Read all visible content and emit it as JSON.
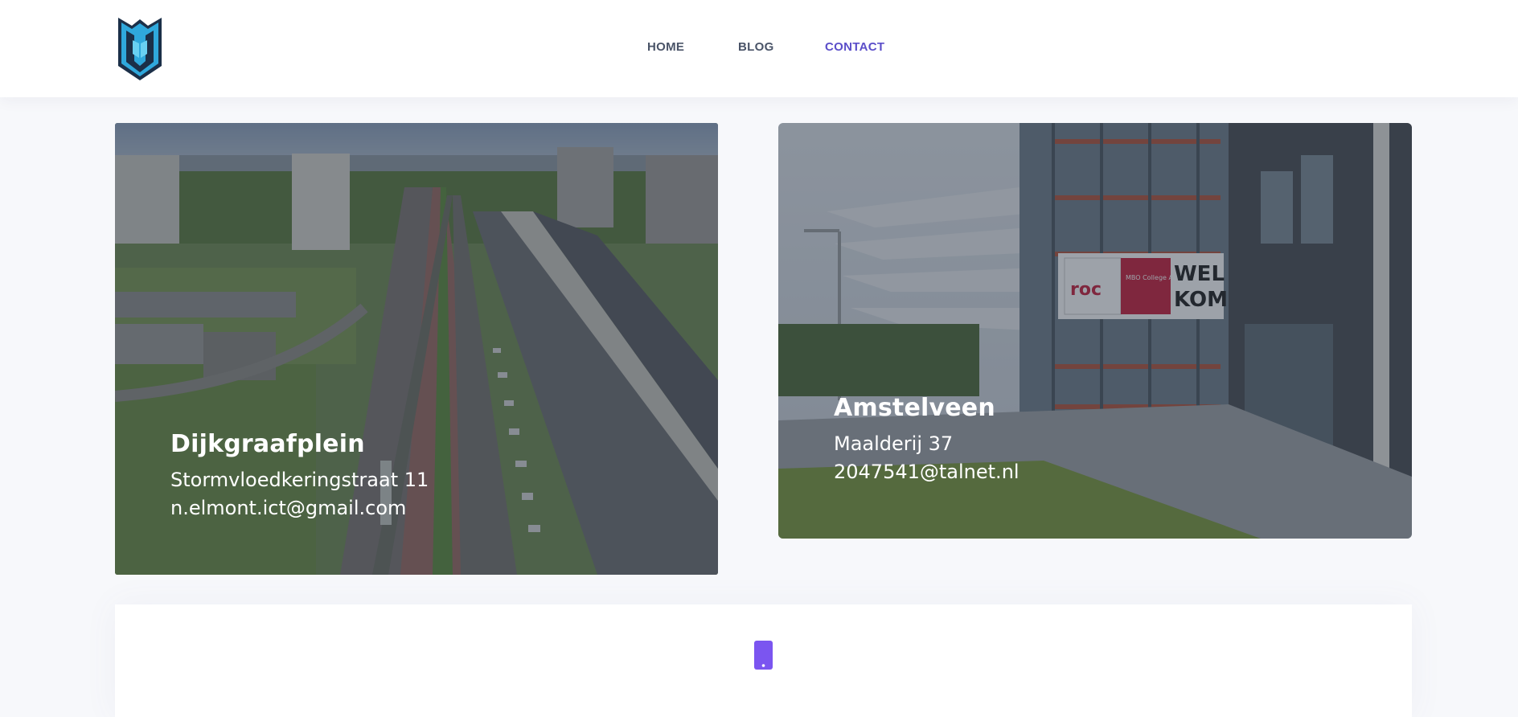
{
  "nav": {
    "items": [
      {
        "label": "HOME"
      },
      {
        "label": "BLOG"
      },
      {
        "label": "CONTACT"
      }
    ],
    "active": "CONTACT"
  },
  "locations": [
    {
      "title": "Dijkgraafplein",
      "address": "Stormvloedkeringstraat 11",
      "email": "n.elmont.ict@gmail.com"
    },
    {
      "title": "Amstelveen",
      "address": "Maalderij 37",
      "email": "2047541@talnet.nl"
    }
  ],
  "sign": {
    "roc": "roc",
    "mbo": "MBO College Amstelland",
    "welkom_top": "WEL",
    "welkom_bottom": "KOM"
  },
  "colors": {
    "accent": "#5b4ec9",
    "nav_text": "#4a5468",
    "phone_icon": "#7b55f0",
    "logo_blue": "#2fa8dc"
  },
  "icons": {
    "logo": "shield-logo-icon",
    "contact": "phone-icon"
  }
}
